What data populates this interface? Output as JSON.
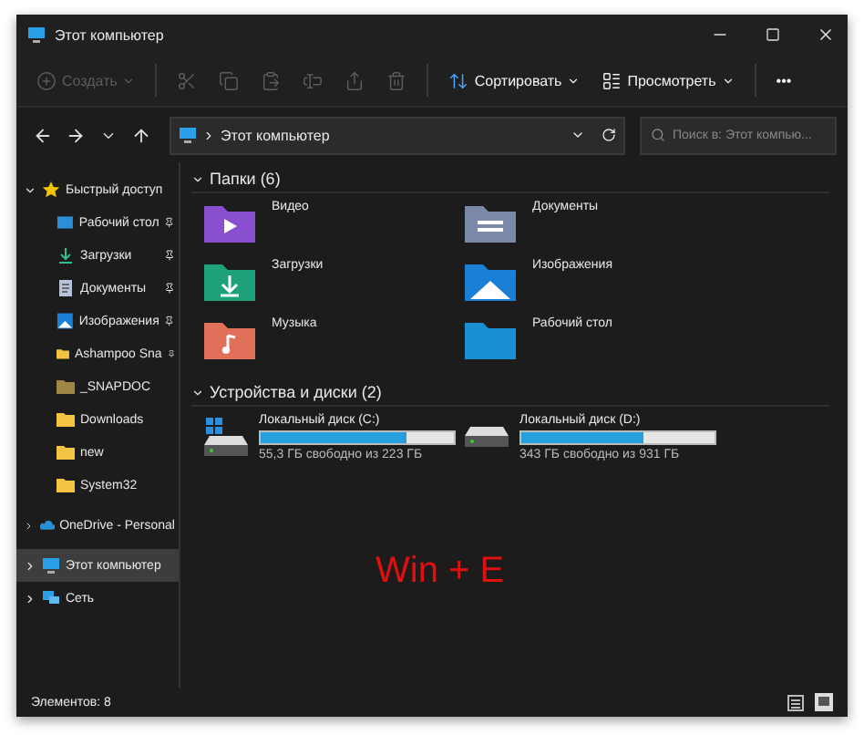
{
  "window": {
    "title": "Этот компьютер"
  },
  "toolbar": [
    {
      "kind": "new",
      "label": "Создать",
      "disabled": true,
      "dropdown": true
    },
    {
      "kind": "cut",
      "disabled": true
    },
    {
      "kind": "copy",
      "disabled": true
    },
    {
      "kind": "paste",
      "disabled": true
    },
    {
      "kind": "rename",
      "disabled": true
    },
    {
      "kind": "share",
      "disabled": true
    },
    {
      "kind": "delete",
      "disabled": true
    },
    {
      "kind": "sort",
      "label": "Сортировать",
      "disabled": false,
      "dropdown": true
    },
    {
      "kind": "view",
      "label": "Просмотреть",
      "disabled": false,
      "dropdown": true
    },
    {
      "kind": "more",
      "label": "•••",
      "disabled": false,
      "dropdown": false
    }
  ],
  "address": {
    "path": "Этот компьютер",
    "search_placeholder": "Поиск в: Этот компью..."
  },
  "sidebar": {
    "items": [
      {
        "label": "Быстрый доступ",
        "kind": "star",
        "expanded": true,
        "selected": false,
        "children": [
          {
            "label": "Рабочий стол",
            "kind": "desktop",
            "pinned": true,
            "selected": false
          },
          {
            "label": "Загрузки",
            "kind": "downloads",
            "pinned": true,
            "selected": false
          },
          {
            "label": "Документы",
            "kind": "documents",
            "pinned": true,
            "selected": false
          },
          {
            "label": "Изображения",
            "kind": "pictures",
            "pinned": true,
            "selected": false
          },
          {
            "label": "Ashampoo Sna",
            "kind": "folder",
            "pinned": true,
            "selected": false
          },
          {
            "label": "_SNAPDOC",
            "kind": "folder-dark",
            "pinned": false,
            "selected": false
          },
          {
            "label": "Downloads",
            "kind": "folder",
            "pinned": false,
            "selected": false
          },
          {
            "label": "new",
            "kind": "folder",
            "pinned": false,
            "selected": false
          },
          {
            "label": "System32",
            "kind": "folder",
            "pinned": false,
            "selected": false
          }
        ]
      },
      {
        "label": "OneDrive - Personal",
        "kind": "cloud",
        "expanded": false,
        "selected": false
      },
      {
        "label": "Этот компьютер",
        "kind": "computer",
        "expanded": false,
        "selected": true
      },
      {
        "label": "Сеть",
        "kind": "network",
        "expanded": false,
        "selected": false
      }
    ]
  },
  "folders": {
    "title": "Папки (6)",
    "items": [
      {
        "label": "Видео",
        "kind": "video"
      },
      {
        "label": "Документы",
        "kind": "documents"
      },
      {
        "label": "Загрузки",
        "kind": "downloads"
      },
      {
        "label": "Изображения",
        "kind": "pictures"
      },
      {
        "label": "Музыка",
        "kind": "music"
      },
      {
        "label": "Рабочий стол",
        "kind": "desktop"
      }
    ]
  },
  "drives": {
    "title": "Устройства и диски (2)",
    "items": [
      {
        "label": "Локальный диск (C:)",
        "free": "55,3 ГБ свободно из 223 ГБ",
        "level": 0.75,
        "system": true
      },
      {
        "label": "Локальный диск (D:)",
        "free": "343 ГБ свободно из 931 ГБ",
        "level": 0.63,
        "system": false
      }
    ]
  },
  "overlay_caption": "Win + E",
  "status_bar": {
    "count": "Элементов: 8"
  }
}
